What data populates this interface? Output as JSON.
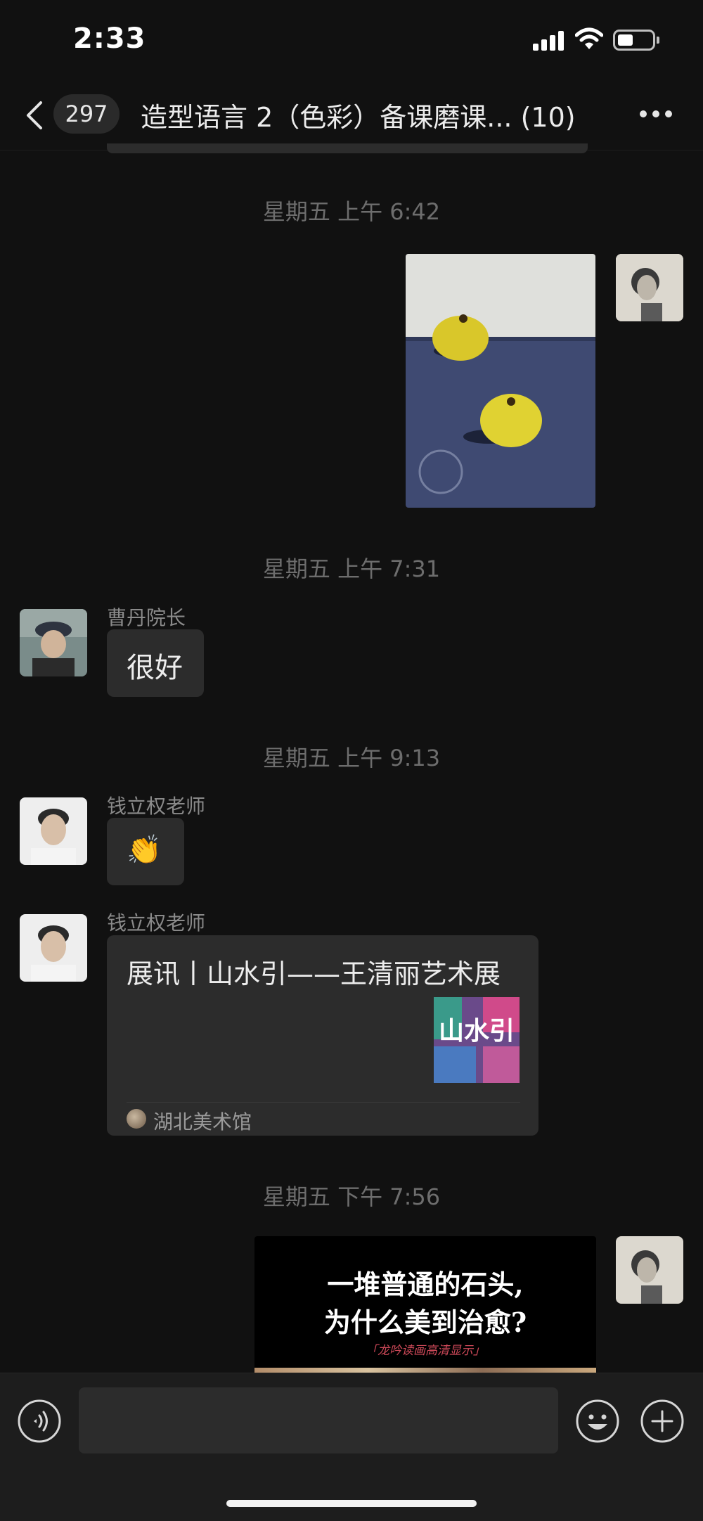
{
  "status_bar": {
    "time": "2:33",
    "battery_level": 0.45
  },
  "nav": {
    "unread_count": "297",
    "title": "造型语言 2（色彩）备课磨课...",
    "member_count": "(10)"
  },
  "messages": {
    "ts1": "星期五 上午 6:42",
    "ts2": "星期五 上午 7:31",
    "sender1": "曹丹院长",
    "text1": "很好",
    "ts3": "星期五 上午 9:13",
    "sender2": "钱立权老师",
    "emoji1": "👏",
    "sender3": "钱立权老师",
    "link_title": "展讯丨山水引——王清丽艺术展",
    "link_thumb_text": "山水引",
    "link_source": "湖北美术馆",
    "ts4": "星期五 下午 7:56",
    "poster_line1": "一堆普通的石头,",
    "poster_line2": "为什么美到治愈?",
    "poster_sub": "「龙吟读画高清显示」"
  },
  "colors": {
    "background": "#111111",
    "bubble": "#2c2c2c",
    "timestamp": "#6d6d6d",
    "poster_accent": "#d04a5a"
  }
}
